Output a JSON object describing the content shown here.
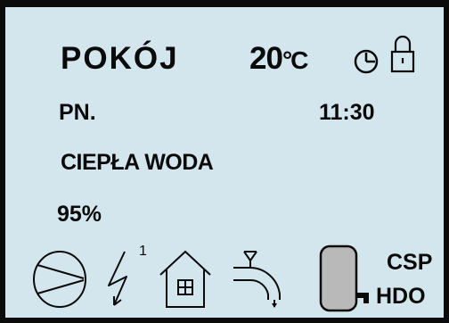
{
  "display": {
    "room_label": "POKÓJ",
    "temperature_value": "20",
    "temperature_unit": "°C",
    "day": "PN.",
    "time": "11:30",
    "mode": "CIEPŁA WODA",
    "percent": "95%",
    "relay_number": "1",
    "csp_label": "CSP",
    "hdo_label": "HDO"
  },
  "colors": {
    "screen_background": "#d4e6ed",
    "frame": "#0b0b0b",
    "tank_fill": "#b9b9b9",
    "foreground": "#0a0a0a"
  },
  "icons": {
    "clock": "clock-icon",
    "lock": "lock-icon",
    "pump": "pump-icon",
    "lightning": "lightning-icon",
    "house": "house-icon",
    "faucet": "faucet-icon",
    "tank": "tank-icon"
  }
}
